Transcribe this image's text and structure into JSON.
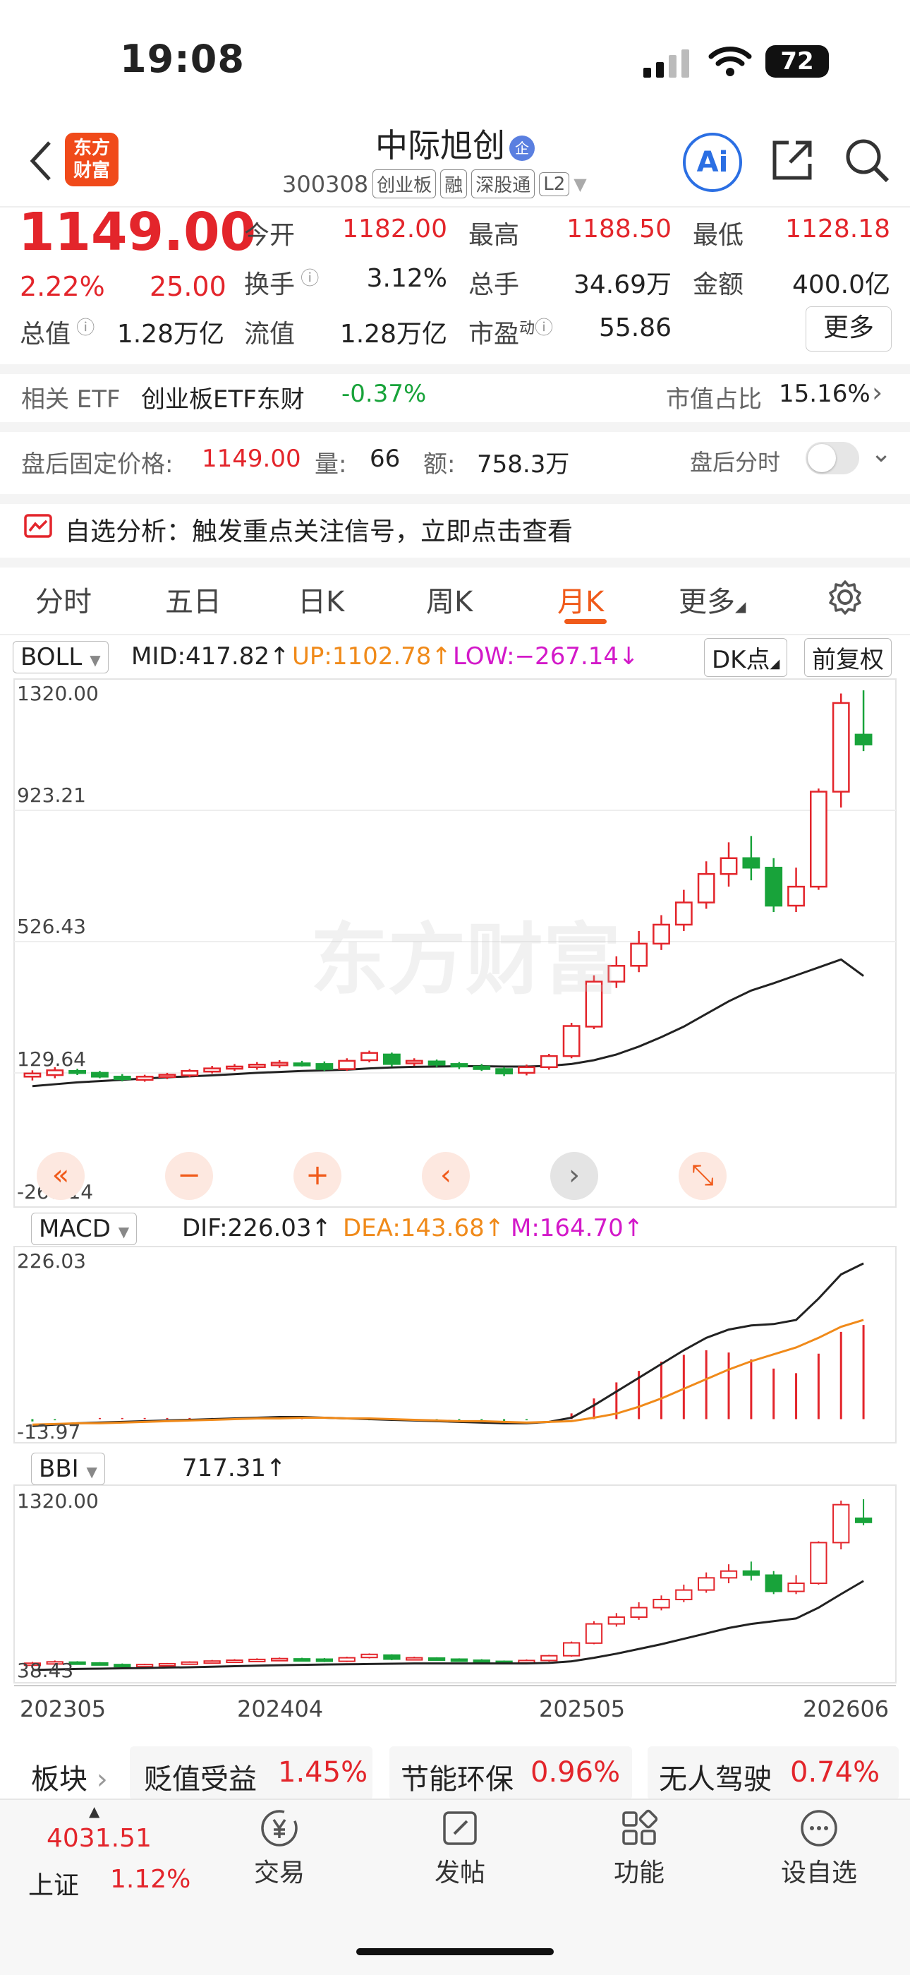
{
  "status": {
    "time": "19:08",
    "battery": "72"
  },
  "header": {
    "logo": "东方\n财富",
    "name": "中际旭创",
    "code": "300308",
    "tags": [
      "创业板",
      "融",
      "深股通",
      "L2"
    ],
    "ai": "Ai"
  },
  "quote": {
    "price": "1149.00",
    "pct": "2.22%",
    "chg": "25.00",
    "open_label": "今开",
    "open": "1182.00",
    "high_label": "最高",
    "high": "1188.50",
    "low_label": "最低",
    "low": "1128.18",
    "turnover_label": "换手",
    "turnover": "3.12%",
    "vol_label": "总手",
    "vol": "34.69万",
    "amount_label": "金额",
    "amount": "400.0亿",
    "mcap_label": "总值",
    "mcap": "1.28万亿",
    "float_label": "流值",
    "float": "1.28万亿",
    "pe_label": "市盈",
    "pe_sup": "动",
    "pe": "55.86",
    "more": "更多"
  },
  "etf": {
    "label": "相关 ETF",
    "name": "创业板ETF东财",
    "pct": "-0.37%",
    "share_label": "市值占比",
    "share": "15.16%"
  },
  "afterhours": {
    "label": "盘后固定价格:",
    "price": "1149.00",
    "vol_label": "量:",
    "vol": "66",
    "amt_label": "额:",
    "amt": "758.3万",
    "toggle_label": "盘后分时"
  },
  "analysis": {
    "text": "自选分析：触发重点关注信号，立即点击查看"
  },
  "tabs": [
    "分时",
    "五日",
    "日K",
    "周K",
    "月K",
    "更多"
  ],
  "boll": {
    "name": "BOLL",
    "mid": "MID:417.82↑",
    "up": "UP:1102.78↑",
    "low": "LOW:−267.14↓",
    "dk": "DK点",
    "fq": "前复权",
    "y_top": "1320.00",
    "y_2": "923.21",
    "y_3": "526.43",
    "y_4": "129.64",
    "y_bot": "-267.14"
  },
  "macd": {
    "name": "MACD",
    "dif": "DIF:226.03↑",
    "dea": "DEA:143.68↑",
    "m": "M:164.70↑",
    "y_top": "226.03",
    "y_bot": "-13.97"
  },
  "bbi": {
    "name": "BBI",
    "val": "717.31↑",
    "y_top": "1320.00",
    "y_bot": "38.43"
  },
  "x_axis": [
    "202305",
    "202404",
    "202505",
    "202606"
  ],
  "sectors": {
    "label": "板块",
    "items": [
      {
        "name": "贬值受益",
        "pct": "1.45%"
      },
      {
        "name": "节能环保",
        "pct": "0.96%"
      },
      {
        "name": "无人驾驶",
        "pct": "0.74%"
      }
    ]
  },
  "nav": {
    "index_val": "4031.51",
    "index_name": "上证",
    "index_pct": "1.12%",
    "items": [
      "交易",
      "发帖",
      "功能",
      "设自选"
    ]
  },
  "watermark": "东方财富",
  "chart_data": {
    "type": "candlestick",
    "x_labels": [
      "202305",
      "202404",
      "202505",
      "202606"
    ],
    "ylim": [
      -267.14,
      1320
    ],
    "candles": [
      [
        100,
        110,
        88,
        120
      ],
      [
        105,
        120,
        95,
        130
      ],
      [
        118,
        112,
        105,
        125
      ],
      [
        112,
        100,
        95,
        118
      ],
      [
        100,
        92,
        85,
        108
      ],
      [
        90,
        100,
        84,
        106
      ],
      [
        99,
        106,
        92,
        112
      ],
      [
        104,
        118,
        98,
        124
      ],
      [
        116,
        126,
        110,
        134
      ],
      [
        125,
        132,
        118,
        140
      ],
      [
        130,
        138,
        122,
        146
      ],
      [
        136,
        144,
        128,
        152
      ],
      [
        142,
        140,
        132,
        150
      ],
      [
        140,
        124,
        118,
        148
      ],
      [
        124,
        150,
        118,
        158
      ],
      [
        152,
        175,
        145,
        182
      ],
      [
        170,
        140,
        132,
        176
      ],
      [
        142,
        150,
        134,
        158
      ],
      [
        148,
        138,
        130,
        154
      ],
      [
        140,
        132,
        124,
        146
      ],
      [
        132,
        124,
        118,
        140
      ],
      [
        124,
        110,
        102,
        130
      ],
      [
        112,
        130,
        104,
        138
      ],
      [
        130,
        165,
        122,
        172
      ],
      [
        165,
        260,
        158,
        270
      ],
      [
        258,
        400,
        250,
        420
      ],
      [
        400,
        450,
        380,
        480
      ],
      [
        450,
        520,
        430,
        560
      ],
      [
        520,
        580,
        500,
        610
      ],
      [
        580,
        650,
        560,
        690
      ],
      [
        650,
        740,
        630,
        780
      ],
      [
        740,
        790,
        700,
        840
      ],
      [
        790,
        760,
        720,
        860
      ],
      [
        760,
        640,
        620,
        790
      ],
      [
        640,
        700,
        620,
        760
      ],
      [
        700,
        1000,
        690,
        1010
      ],
      [
        1000,
        1280,
        950,
        1310
      ],
      [
        1180,
        1149,
        1128,
        1320
      ]
    ],
    "series": [
      {
        "name": "MID",
        "values": [
          70,
          76,
          82,
          86,
          90,
          94,
          98,
          101,
          104,
          108,
          112,
          115,
          118,
          120,
          122,
          126,
          129,
          131,
          132,
          133,
          133,
          132,
          132,
          134,
          140,
          152,
          170,
          195,
          225,
          258,
          298,
          338,
          372,
          395,
          420,
          445,
          470,
          418
        ]
      }
    ],
    "macd": {
      "dif": [
        -10,
        -8,
        -6,
        -5,
        -4,
        -3,
        -2,
        -1,
        0,
        1,
        2,
        3,
        3,
        2,
        1,
        0,
        -1,
        -2,
        -3,
        -4,
        -5,
        -6,
        -6,
        -4,
        2,
        20,
        40,
        60,
        80,
        100,
        118,
        130,
        136,
        138,
        144,
        175,
        210,
        226
      ],
      "dea": [
        -8,
        -7,
        -6,
        -6,
        -5,
        -4,
        -3,
        -2,
        -1,
        0,
        1,
        1,
        2,
        2,
        1,
        1,
        0,
        -1,
        -2,
        -3,
        -3,
        -4,
        -5,
        -4,
        -3,
        2,
        8,
        18,
        30,
        44,
        58,
        72,
        84,
        94,
        104,
        118,
        134,
        144
      ]
    },
    "bbi": {
      "values": [
        60,
        64,
        68,
        70,
        72,
        74,
        78,
        80,
        84,
        88,
        92,
        95,
        98,
        100,
        102,
        104,
        106,
        108,
        108,
        108,
        108,
        108,
        108,
        112,
        124,
        150,
        180,
        215,
        250,
        290,
        330,
        370,
        400,
        420,
        440,
        520,
        620,
        717
      ]
    }
  }
}
